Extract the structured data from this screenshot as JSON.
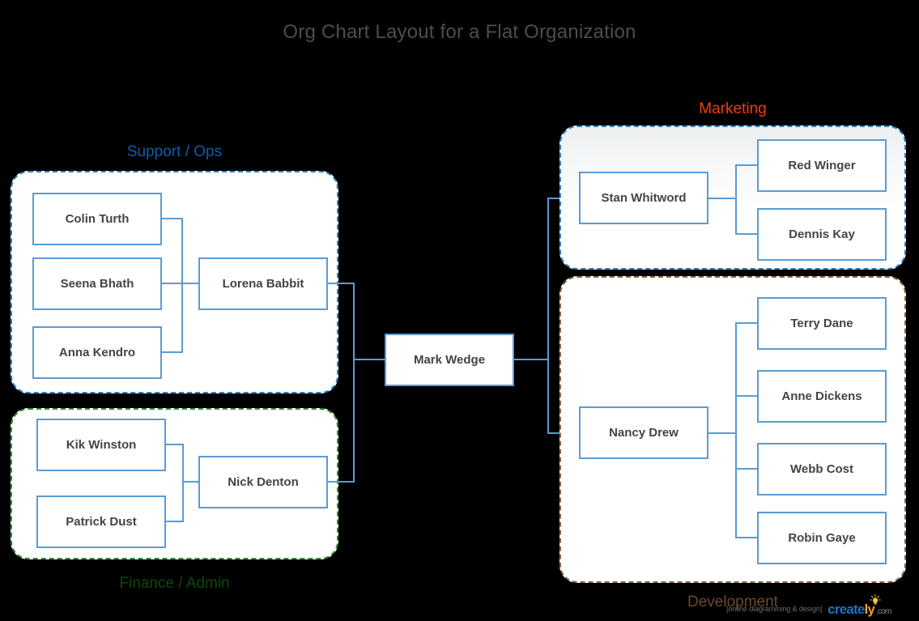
{
  "title": "Org Chart Layout for a Flat Organization",
  "groups": [
    {
      "id": "support-ops",
      "label": "Support / Ops",
      "label_color": "#0d5ca8",
      "border_color": "#2e7fc1",
      "border_style": "dashed",
      "label_position": "above"
    },
    {
      "id": "finance-admin",
      "label": "Finance / Admin",
      "label_color": "#0b4a0b",
      "border_color": "#2e8b2e",
      "border_style": "dashed",
      "label_position": "below"
    },
    {
      "id": "marketing",
      "label": "Marketing",
      "label_color": "#ee3d11",
      "border_color": "#2e7fc1",
      "border_style": "dashed",
      "label_position": "above"
    },
    {
      "id": "development",
      "label": "Development",
      "label_color": "#6b4a2e",
      "border_color": "#8a6240",
      "border_style": "dashed",
      "label_position": "below"
    }
  ],
  "nodes": {
    "root": "Mark Wedge",
    "colin": "Colin Turth",
    "seena": "Seena Bhath",
    "anna": "Anna Kendro",
    "lorena": "Lorena Babbit",
    "kik": "Kik Winston",
    "patrick": "Patrick Dust",
    "nick": "Nick Denton",
    "stan": "Stan Whitword",
    "red": "Red Winger",
    "dennis": "Dennis Kay",
    "nancy": "Nancy Drew",
    "terry": "Terry Dane",
    "anne": "Anne Dickens",
    "webb": "Webb Cost",
    "robin": "Robin Gaye"
  },
  "chart_data": {
    "type": "diagram",
    "diagram_type": "org-chart",
    "title": "Org Chart Layout for a Flat Organization",
    "root": "Mark Wedge",
    "node_style": {
      "fill": "#ffffff",
      "border": "#5b9bd5",
      "text": "#444444"
    },
    "connector_color": "#5b9bd5",
    "background": "#000000",
    "groups": [
      {
        "name": "Support / Ops",
        "lead": "Lorena Babbit",
        "members": [
          "Colin Turth",
          "Seena Bhath",
          "Anna Kendro"
        ],
        "side": "left"
      },
      {
        "name": "Finance / Admin",
        "lead": "Nick Denton",
        "members": [
          "Kik Winston",
          "Patrick Dust"
        ],
        "side": "left"
      },
      {
        "name": "Marketing",
        "lead": "Stan Whitword",
        "members": [
          "Red Winger",
          "Dennis Kay"
        ],
        "side": "right"
      },
      {
        "name": "Development",
        "lead": "Nancy Drew",
        "members": [
          "Terry Dane",
          "Anne Dickens",
          "Webb Cost",
          "Robin Gaye"
        ],
        "side": "right"
      }
    ],
    "edges": [
      [
        "Mark Wedge",
        "Lorena Babbit"
      ],
      [
        "Mark Wedge",
        "Nick Denton"
      ],
      [
        "Mark Wedge",
        "Stan Whitword"
      ],
      [
        "Mark Wedge",
        "Nancy Drew"
      ],
      [
        "Lorena Babbit",
        "Colin Turth"
      ],
      [
        "Lorena Babbit",
        "Seena Bhath"
      ],
      [
        "Lorena Babbit",
        "Anna Kendro"
      ],
      [
        "Nick Denton",
        "Kik Winston"
      ],
      [
        "Nick Denton",
        "Patrick Dust"
      ],
      [
        "Stan Whitword",
        "Red Winger"
      ],
      [
        "Stan Whitword",
        "Dennis Kay"
      ],
      [
        "Nancy Drew",
        "Terry Dane"
      ],
      [
        "Nancy Drew",
        "Anne Dickens"
      ],
      [
        "Nancy Drew",
        "Webb Cost"
      ],
      [
        "Nancy Drew",
        "Robin Gaye"
      ]
    ]
  },
  "watermark": {
    "tagline": "[online diagramming & design]",
    "brand_primary": "create",
    "brand_accent": "ly",
    "brand_suffix": ".com"
  }
}
